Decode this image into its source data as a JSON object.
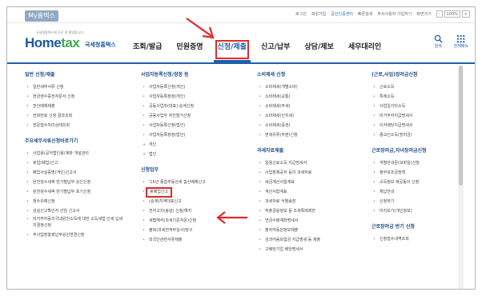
{
  "topbar": {
    "my_tab": "My홈택스",
    "links": [
      "로그인",
      "회원가입",
      "공인인증센터",
      "빠른검색",
      "부서사용자 가입하기",
      "화면크기"
    ],
    "zoom": "100%",
    "zoom_minus": "-",
    "zoom_plus": "+"
  },
  "header": {
    "logo_main": "Home",
    "logo_accent": "tax",
    "logo_tagline": "국세청홈택스에 오신 걸 환영합니다",
    "logo_korean": "국세청홈택스",
    "nav": [
      "조회/발급",
      "민원증명",
      "신청/제출",
      "신고/납부",
      "상담/제보",
      "세무대리인"
    ],
    "search_label": "검색",
    "menu_label": "전체메뉴"
  },
  "columns": {
    "col1": {
      "title1": "일반 신청/제출",
      "items1": [
        "일반세무서류 신청",
        "현금영수증전자문서 신청",
        "전산매체제출",
        "전화번호 신청 결과조회",
        "방문접수처리상태조회"
      ],
      "title2": "주요세무서류신청바로가기",
      "items2": [
        "사업용(공익법인용)계좌 개설관리",
        "휴업(폐업)신고",
        "폐업사실증명(개인)신고서",
        "원천징수세액 반기별납부 승인신청",
        "원천징수세액 반기별납부 포기신청",
        "정수유예신청",
        "성실신고확인자 선임 신고서",
        "비거주자등의국내원천소득에 대한 소득세법 인세 납세지결정신청",
        "주사업장총괄납부승인변경신청"
      ]
    },
    "col2": {
      "title1": "사업자등록신청/정정 등",
      "items1": [
        "사업자등록신청(개인)",
        "사업자등록정정(개인)",
        "공동사업자(대표) 승계신청",
        "공동사업자 자진철거신청",
        "사업자등록신청(법인)",
        "사업자등록정정(법인)"
      ],
      "plus": [
        "개인",
        "법인"
      ],
      "title2": "신청업무",
      "items2": [
        "'15년 종합부동산세 합산배제신고",
        "휴폐업신고",
        "(승계)지역대표신고",
        "전자고지(송달) 신청/해지",
        "세법해석(과세기준자문)신청",
        "불복(과세전적부심사)청구",
        "외국인관련서류제출"
      ]
    },
    "col3": {
      "title1": "소비제세 신청",
      "items1": [
        "소비제세(개별소비)",
        "소비제세(교통)",
        "소비제세(주세)",
        "소비제세(인지세)",
        "소비제세(증권)",
        "면세유류(부분)신청"
      ],
      "title2": "과세자료제출",
      "items2": [
        "일용근로소득 지급명세서",
        "사업장제공자 등의 과세자료",
        "세금계산서합계표",
        "계산서합계표",
        "과세자료 식별송장",
        "적출금융정보 등 조세특례제한",
        "연금수령계좌명세서",
        "출자자동원정보제출",
        "성과어음보험금 지급명세 등 제출",
        "고배당기업 배당명세서"
      ]
    },
    "col4": {
      "title1": "(근로,사업)장려금신청",
      "items1": [
        "근로소득",
        "특례소득",
        "사업일기타소득",
        "비거주자지급명세서",
        "이자배당지급명세서",
        "종교인소득(장려금)"
      ],
      "title2": "근로장려금,자녀장려금신청",
      "items2": [
        "개별안내문(모바일)신청",
        "정부보조금정책",
        "소득정보 제공동의 신청",
        "체납안내",
        "신청하기",
        "미리보기(개인정보)"
      ],
      "title3": "근로장려금 반기 신청",
      "items3": [
        "신청접수내역조회"
      ]
    }
  },
  "colors": {
    "brand_blue": "#1f5fae",
    "brand_green": "#41a94f",
    "annotation_red": "#e12a2a"
  },
  "icons": [
    "search-icon",
    "grid-menu-icon",
    "arrow-annotation-icon"
  ]
}
